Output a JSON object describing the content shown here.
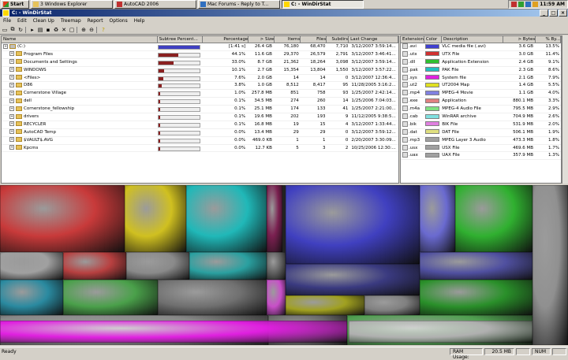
{
  "taskbar": {
    "start": "Start",
    "buttons": [
      "3 Windows Explorer",
      "AutoCAD 2006",
      "Mac Forums - Reply to T...",
      "C: - WinDirStat"
    ],
    "clock": "11:59 AM"
  },
  "window": {
    "title": "C: - WinDirStat"
  },
  "menu": [
    "File",
    "Edit",
    "Clean Up",
    "Treemap",
    "Report",
    "Options",
    "Help"
  ],
  "dir_list": {
    "columns": [
      "Name",
      "Subtree Percent...",
      "Percentage",
      "> Size",
      "Items",
      "Files",
      "Subdirs",
      "Last Change"
    ],
    "rows": [
      {
        "name": "(C:)",
        "pct": "[1:41 s]",
        "fill": 1.0,
        "size": "26.4 GB",
        "items": "76,180",
        "files": "68,470",
        "subdirs": "7,710",
        "date": "3/12/2007  3:59:14..."
      },
      {
        "name": "Program Files",
        "pct": "44.1%",
        "fill": 0.44,
        "size": "11.6 GB",
        "items": "29,370",
        "files": "26,579",
        "subdirs": "2,791",
        "date": "3/12/2007  3:46:41..."
      },
      {
        "name": "Documents and Settings",
        "pct": "33.0%",
        "fill": 0.33,
        "size": "8.7 GB",
        "items": "21,362",
        "files": "18,264",
        "subdirs": "3,098",
        "date": "3/12/2007  3:59:14..."
      },
      {
        "name": "WINDOWS",
        "pct": "10.1%",
        "fill": 0.1,
        "size": "2.7 GB",
        "items": "15,354",
        "files": "13,804",
        "subdirs": "1,550",
        "date": "3/12/2007  3:57:22..."
      },
      {
        "name": "<Files>",
        "pct": "7.6%",
        "fill": 0.076,
        "size": "2.0 GB",
        "items": "14",
        "files": "14",
        "subdirs": "0",
        "date": "3/12/2007  12:36:4..."
      },
      {
        "name": "D86",
        "pct": "3.8%",
        "fill": 0.038,
        "size": "1.0 GB",
        "items": "8,512",
        "files": "8,417",
        "subdirs": "95",
        "date": "11/28/2005  3:16:2..."
      },
      {
        "name": "Cornerstone Village",
        "pct": "1.0%",
        "fill": 0.01,
        "size": "257.8 MB",
        "items": "851",
        "files": "758",
        "subdirs": "93",
        "date": "1/25/2007  2:42:14..."
      },
      {
        "name": "dell",
        "pct": "0.1%",
        "fill": 0.001,
        "size": "34.5 MB",
        "items": "274",
        "files": "260",
        "subdirs": "14",
        "date": "1/25/2006  7:04:03..."
      },
      {
        "name": "Cornerstone_fellowship",
        "pct": "0.1%",
        "fill": 0.001,
        "size": "25.1 MB",
        "items": "174",
        "files": "133",
        "subdirs": "41",
        "date": "1/25/2007  2:21:00..."
      },
      {
        "name": "drivers",
        "pct": "0.1%",
        "fill": 0.001,
        "size": "19.6 MB",
        "items": "202",
        "files": "193",
        "subdirs": "9",
        "date": "11/12/2005  9:38:5..."
      },
      {
        "name": "RECYCLER",
        "pct": "0.1%",
        "fill": 0.001,
        "size": "16.8 MB",
        "items": "19",
        "files": "15",
        "subdirs": "4",
        "date": "3/12/2007  1:33:44..."
      },
      {
        "name": "AutoCAD Temp",
        "pct": "0.0%",
        "fill": 0.0,
        "size": "13.4 MB",
        "items": "29",
        "files": "29",
        "subdirs": "0",
        "date": "3/12/2007  3:59:12..."
      },
      {
        "name": "$VAULT$.AVG",
        "pct": "0.0%",
        "fill": 0.0,
        "size": "469.0 KB",
        "items": "1",
        "files": "1",
        "subdirs": "0",
        "date": "2/20/2007  3:30:09..."
      },
      {
        "name": "Kpcms",
        "pct": "0.0%",
        "fill": 0.0,
        "size": "12.7 KB",
        "items": "5",
        "files": "3",
        "subdirs": "2",
        "date": "10/25/2006  12:30:..."
      }
    ]
  },
  "ext_list": {
    "columns": [
      "Extension",
      "Color",
      "Description",
      "> Bytes",
      "% By..."
    ],
    "rows": [
      {
        "ext": ".avi",
        "color": "#4040d0",
        "desc": "VLC media file (.avi)",
        "bytes": "3.6 GB",
        "pct": "13.5%"
      },
      {
        "ext": ".utx",
        "color": "#d03030",
        "desc": "UTX File",
        "bytes": "3.0 GB",
        "pct": "11.4%"
      },
      {
        "ext": ".dll",
        "color": "#30c030",
        "desc": "Application Extension",
        "bytes": "2.4 GB",
        "pct": "9.1%"
      },
      {
        "ext": ".pak",
        "color": "#20c0c0",
        "desc": "PAK File",
        "bytes": "2.3 GB",
        "pct": "8.6%"
      },
      {
        "ext": ".sys",
        "color": "#e020e0",
        "desc": "System file",
        "bytes": "2.1 GB",
        "pct": "7.9%"
      },
      {
        "ext": ".ut2",
        "color": "#e0e020",
        "desc": "UT2004 Map",
        "bytes": "1.4 GB",
        "pct": "5.5%"
      },
      {
        "ext": ".mp4",
        "color": "#8080e0",
        "desc": "MPEG-4 Movie",
        "bytes": "1.1 GB",
        "pct": "4.0%"
      },
      {
        "ext": ".exe",
        "color": "#e08080",
        "desc": "Application",
        "bytes": "880.1 MB",
        "pct": "3.3%"
      },
      {
        "ext": ".m4a",
        "color": "#80e080",
        "desc": "MPEG-4 Audio File",
        "bytes": "795.5 MB",
        "pct": "2.9%"
      },
      {
        "ext": ".cab",
        "color": "#80e0e0",
        "desc": "WinRAR archive",
        "bytes": "704.9 MB",
        "pct": "2.6%"
      },
      {
        "ext": ".bik",
        "color": "#e080e0",
        "desc": "BIK File",
        "bytes": "531.9 MB",
        "pct": "2.0%"
      },
      {
        "ext": ".dat",
        "color": "#e0e080",
        "desc": "DAT File",
        "bytes": "506.1 MB",
        "pct": "1.9%"
      },
      {
        "ext": ".mp3",
        "color": "#a0a0a0",
        "desc": "MPEG Layer 3 Audio",
        "bytes": "473.3 MB",
        "pct": "1.8%"
      },
      {
        "ext": ".usx",
        "color": "#a0a0a0",
        "desc": "USX File",
        "bytes": "469.6 MB",
        "pct": "1.7%"
      },
      {
        "ext": ".uax",
        "color": "#a0a0a0",
        "desc": "UAX File",
        "bytes": "357.9 MB",
        "pct": "1.3%"
      }
    ]
  },
  "status": {
    "left": "Ready",
    "ram_label": "RAM Usage:",
    "ram": "20.5 MB",
    "num": "NUM"
  }
}
